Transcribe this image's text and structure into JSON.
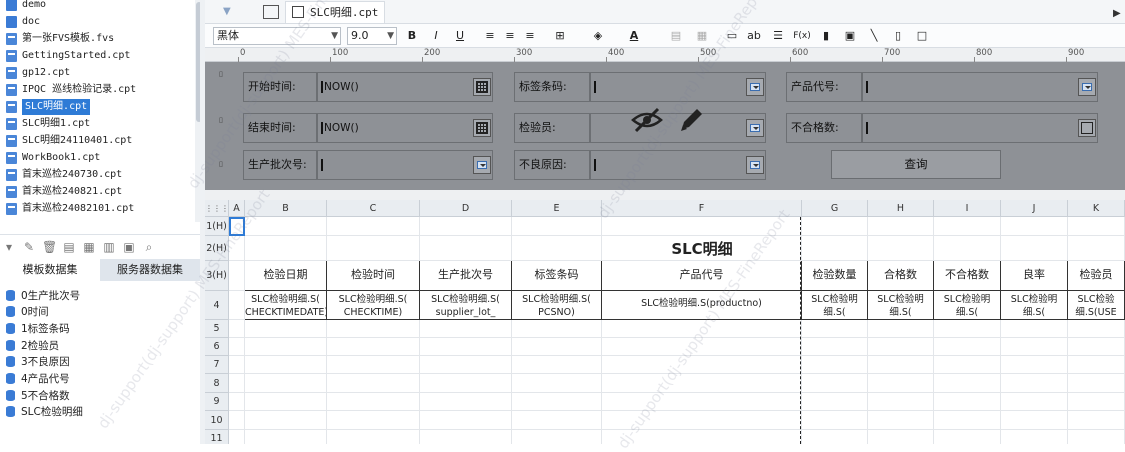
{
  "tree": {
    "items": [
      {
        "label": "demo",
        "type": "folder"
      },
      {
        "label": "doc",
        "type": "folder"
      },
      {
        "label": "第一张FVS模板.fvs",
        "type": "file"
      },
      {
        "label": "GettingStarted.cpt",
        "type": "file"
      },
      {
        "label": "gp12.cpt",
        "type": "file"
      },
      {
        "label": "IPQC 巡线检验记录.cpt",
        "type": "file"
      },
      {
        "label": "SLC明细.cpt",
        "type": "file",
        "selected": true
      },
      {
        "label": "SLC明细1.cpt",
        "type": "file"
      },
      {
        "label": "SLC明细24110401.cpt",
        "type": "file"
      },
      {
        "label": "WorkBook1.cpt",
        "type": "file"
      },
      {
        "label": "首末巡检240730.cpt",
        "type": "file"
      },
      {
        "label": "首末巡检240821.cpt",
        "type": "file"
      },
      {
        "label": "首末巡检24082101.cpt",
        "type": "file"
      }
    ]
  },
  "left_toolbar": {
    "icons": [
      "collapse-icon",
      "edit-icon",
      "delete-icon",
      "preview-icon",
      "dataset-icon",
      "server-icon",
      "db-icon",
      "search-icon"
    ]
  },
  "dataset_tabs": {
    "template": "模板数据集",
    "server": "服务器数据集"
  },
  "dataset_list": [
    "0生产批次号",
    "0时间",
    "1标签条码",
    "2检验员",
    "3不良原因",
    "4产品代号",
    "5不合格数",
    "SLC检验明细"
  ],
  "tabbar": {
    "doc_tab": "SLC明细.cpt"
  },
  "toolbar": {
    "font_name": "黑体",
    "font_size": "9.0",
    "bold": "B",
    "italic": "I",
    "underline": "U",
    "text_color_letter": "A",
    "ab_label": "ab",
    "fx_label": "F(x)"
  },
  "ruler": {
    "labels": [
      "0",
      "100",
      "200",
      "300",
      "400",
      "500",
      "600",
      "700",
      "800",
      "900"
    ]
  },
  "form": {
    "start_time_label": "开始时间:",
    "start_time_value": "NOW()",
    "end_time_label": "结束时间:",
    "end_time_value": "NOW()",
    "batch_label": "生产批次号:",
    "tag_label": "标签条码:",
    "inspector_label": "检验员:",
    "defect_label": "不良原因:",
    "product_label": "产品代号:",
    "unqualified_label": "不合格数:",
    "query_button": "查询"
  },
  "grid": {
    "corner": "⋮⋮⋮",
    "columns": [
      "A",
      "B",
      "C",
      "D",
      "E",
      "F",
      "G",
      "H",
      "I",
      "J",
      "K"
    ],
    "rows": [
      "1(H)",
      "2(H)",
      "3(H)",
      "4",
      "5",
      "6",
      "7",
      "8",
      "9",
      "10",
      "11"
    ],
    "title": "SLC明细",
    "headers": [
      "检验日期",
      "检验时间",
      "生产批次号",
      "标签条码",
      "产品代号",
      "检验数量",
      "合格数",
      "不合格数",
      "良率",
      "检验员"
    ],
    "data_row": [
      "SLC检验明细.S(\nCHECKTIMEDATE)",
      "SLC检验明细.S(\nCHECKTIME)",
      "SLC检验明细.S(\nsupplier_lot_",
      "SLC检验明细.S(\nPCSNO)",
      "SLC检验明细.S(productno)",
      "SLC检验明\n细.S(",
      "SLC检验明\n细.S(",
      "SLC检验明\n细.S(",
      "SLC检验明\n细.S(",
      "SLC检验\n细.S(USE"
    ]
  },
  "watermark": "dj-support(dj-support) MES-FineReport"
}
